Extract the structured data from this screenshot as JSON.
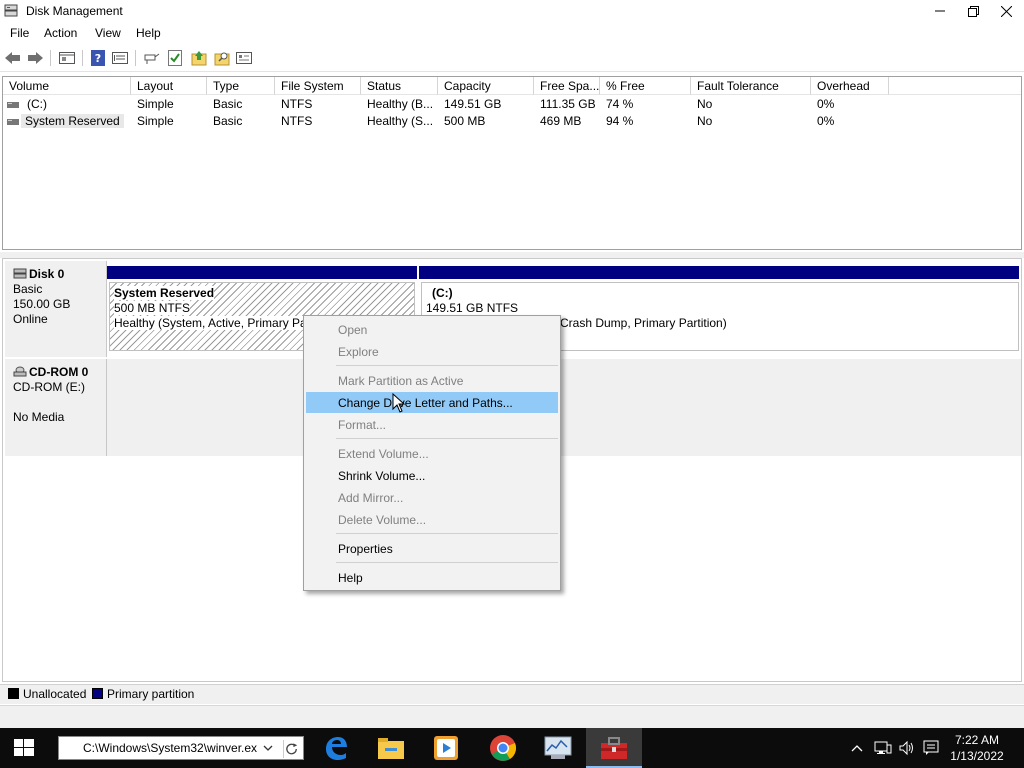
{
  "window": {
    "title": "Disk Management",
    "controls": [
      "minimize",
      "restore",
      "close"
    ]
  },
  "menu": [
    "File",
    "Action",
    "View",
    "Help"
  ],
  "toolbar": {
    "icons": [
      "back-icon",
      "forward-icon",
      "properties-icon",
      "help-icon",
      "disk-list-icon",
      "connect-icon",
      "check-icon",
      "folder-up-icon",
      "folder-search-icon",
      "settings-icon"
    ]
  },
  "volume_list": {
    "columns": [
      "Volume",
      "Layout",
      "Type",
      "File System",
      "Status",
      "Capacity",
      "Free Spa...",
      "% Free",
      "Fault Tolerance",
      "Overhead"
    ],
    "rows": [
      [
        "(C:)",
        "Simple",
        "Basic",
        "NTFS",
        "Healthy (B...",
        "149.51 GB",
        "111.35 GB",
        "74 %",
        "No",
        "0%"
      ],
      [
        "System Reserved",
        "Simple",
        "Basic",
        "NTFS",
        "Healthy (S...",
        "500 MB",
        "469 MB",
        "94 %",
        "No",
        "0%"
      ]
    ]
  },
  "disks": [
    {
      "name": "Disk 0",
      "lines": [
        "Basic",
        "150.00 GB",
        "Online"
      ],
      "partitions": [
        {
          "name": "System Reserved",
          "size": "500 MB NTFS",
          "status": "Healthy (System, Active, Primary Pa"
        },
        {
          "name": "(C:)",
          "size": "149.51 GB NTFS",
          "status": "Crash Dump, Primary Partition)"
        }
      ]
    },
    {
      "name": "CD-ROM 0",
      "lines": [
        "CD-ROM (E:)",
        "",
        "No Media"
      ]
    }
  ],
  "context_menu": {
    "items": [
      {
        "label": "Open",
        "enabled": false
      },
      {
        "label": "Explore",
        "enabled": false
      },
      {
        "label": "Mark Partition as Active",
        "enabled": false
      },
      {
        "label": "Change Drive Letter and Paths...",
        "enabled": true,
        "highlighted": true
      },
      {
        "label": "Format...",
        "enabled": false
      },
      {
        "label": "Extend Volume...",
        "enabled": false
      },
      {
        "label": "Shrink Volume...",
        "enabled": true
      },
      {
        "label": "Add Mirror...",
        "enabled": false
      },
      {
        "label": "Delete Volume...",
        "enabled": false
      },
      {
        "label": "Properties",
        "enabled": true
      },
      {
        "label": "Help",
        "enabled": true
      }
    ]
  },
  "legend": [
    {
      "label": "Unallocated",
      "color": "#000000"
    },
    {
      "label": "Primary partition",
      "color": "#000080"
    }
  ],
  "taskbar": {
    "run_value": "C:\\Windows\\System32\\winver.ex",
    "apps": [
      "edge-icon",
      "file-explorer-icon",
      "media-player-icon",
      "chrome-icon",
      "system-monitor-icon",
      "toolbox-icon"
    ],
    "time": "7:22 AM",
    "date": "1/13/2022"
  },
  "colors": {
    "primary_partition": "#000080",
    "menu_highlight": "#91c9f7",
    "taskbar": "#0c0c0c"
  }
}
